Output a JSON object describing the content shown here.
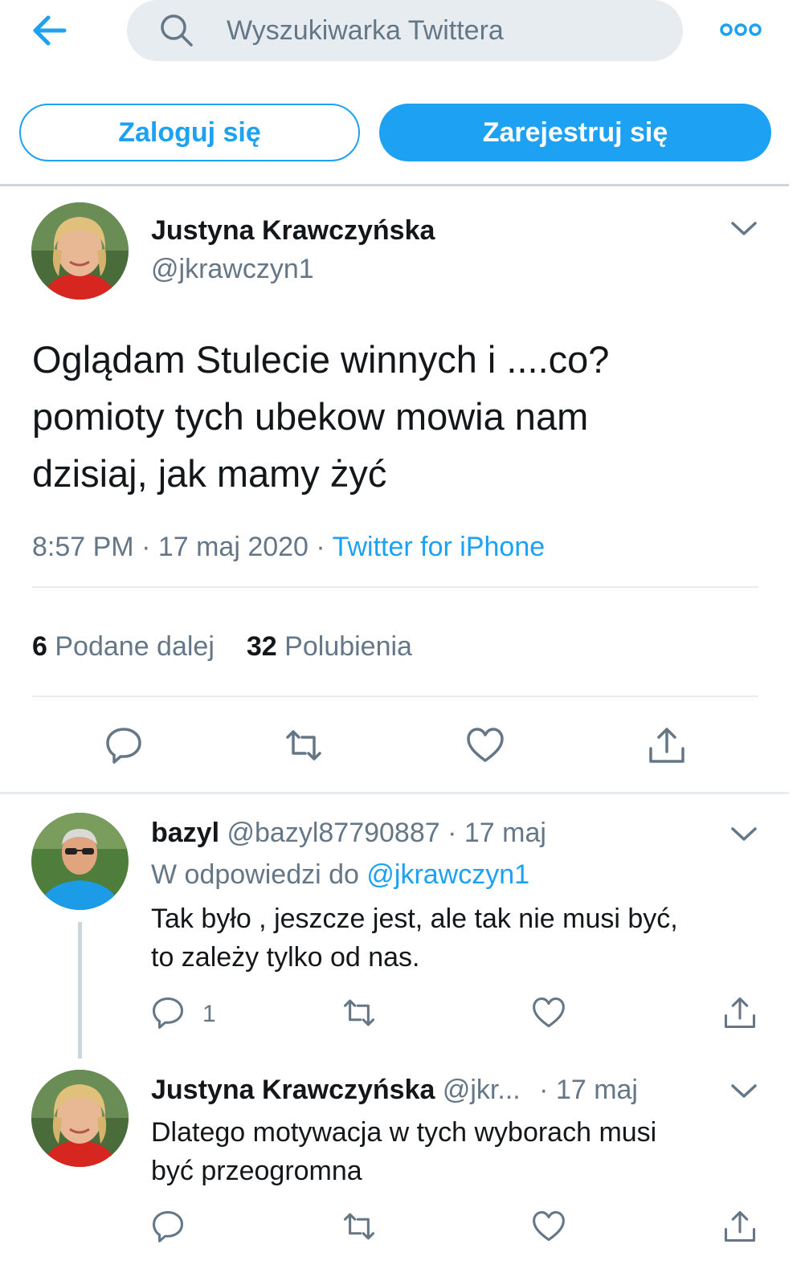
{
  "header": {
    "back_icon": "back-arrow-icon",
    "search_placeholder": "Wyszukiwarka Twittera",
    "search_icon": "search-icon",
    "more_icon": "more-dots-icon",
    "login_label": "Zaloguj się",
    "signup_label": "Zarejestruj się"
  },
  "tweet": {
    "author_name": "Justyna Krawczyńska",
    "author_handle": "@jkrawczyn1",
    "text_line1": "Oglądam Stulecie winnych i ....co?",
    "text_line2": "pomioty tych ubekow mowia nam",
    "text_line3": "dzisiaj, jak mamy żyć",
    "time": "8:57 PM · 17 maj 2020 · ",
    "source": "Twitter for iPhone",
    "retweets_count": "6",
    "retweets_label": "Podane dalej",
    "likes_count": "32",
    "likes_label": "Polubienia"
  },
  "replies": [
    {
      "name": "bazyl",
      "handle": "@bazyl87790887",
      "date": "· 17 maj",
      "replying_prefix": "W odpowiedzi do",
      "replying_to": "@jkrawczyn1",
      "text_line1": "Tak było , jeszcze jest, ale tak nie musi być,",
      "text_line2": "to zależy tylko od nas.",
      "reply_count": "1"
    },
    {
      "name": "Justyna Krawczyńska",
      "handle": "@jkr...",
      "date": "· 17 maj",
      "text_line1": "Dlatego motywacja w tych wyborach musi",
      "text_line2": "być przeogromna"
    }
  ],
  "colors": {
    "accent": "#1da1f2",
    "secondary_text": "#657786",
    "primary_text": "#14171a",
    "search_bg": "#e6ecf0"
  }
}
